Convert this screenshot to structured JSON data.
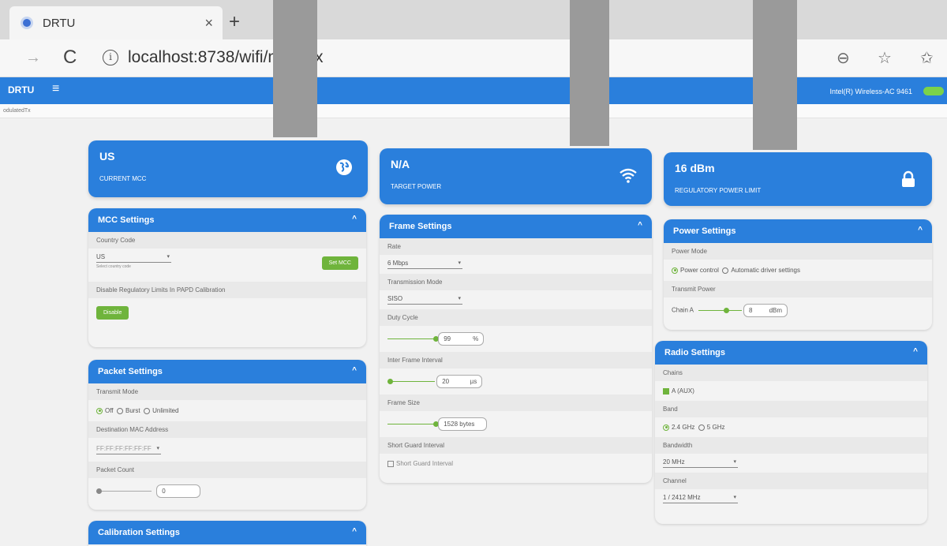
{
  "browser": {
    "tab_title": "DRTU",
    "tab_close": "×",
    "new_tab": "+",
    "forward": "→",
    "reload": "C",
    "info": "i",
    "url": "localhost:8738/wifi/mo          dTx",
    "zoom_icon": "⊖",
    "favorites_add_icon": "☆",
    "favorites_icon": "✩"
  },
  "appbar": {
    "brand": "DRTU",
    "menu_icon": "≡",
    "device": "Intel(R) Wireless-AC 9461"
  },
  "subbar": {
    "path": "odulatedTx"
  },
  "stats": {
    "mcc": {
      "value": "US",
      "label": "CURRENT MCC",
      "icon": "globe-icon"
    },
    "target_power": {
      "value": "N/A",
      "label": "TARGET POWER",
      "icon": "wifi-icon"
    },
    "reg_limit": {
      "value": "16 dBm",
      "label": "REGULATORY POWER LIMIT",
      "icon": "lock-icon"
    }
  },
  "mcc_settings": {
    "title": "MCC Settings",
    "chevron": "^",
    "country_code_label": "Country Code",
    "country_code_value": "US",
    "country_code_helper": "Select country code",
    "set_mcc_button": "Set MCC",
    "disable_label": "Disable Regulatory Limits In PAPD Calibration",
    "disable_button": "Disable"
  },
  "packet_settings": {
    "title": "Packet Settings",
    "chevron": "^",
    "transmit_mode_label": "Transmit Mode",
    "modes": [
      "Off",
      "Burst",
      "Unlimited"
    ],
    "selected_mode": "Off",
    "dest_mac_label": "Destination MAC Address",
    "dest_mac_value": "FF:FF:FF:FF:FF:FF",
    "packet_count_label": "Packet Count",
    "packet_count_value": "0"
  },
  "calibration_settings": {
    "title": "Calibration Settings",
    "chevron": "^"
  },
  "frame_settings": {
    "title": "Frame Settings",
    "chevron": "^",
    "rate_label": "Rate",
    "rate_value": "6 Mbps",
    "tx_mode_label": "Transmission Mode",
    "tx_mode_value": "SISO",
    "duty_cycle_label": "Duty Cycle",
    "duty_cycle_value": "99",
    "duty_cycle_unit": "%",
    "ifi_label": "Inter Frame Interval",
    "ifi_value": "20",
    "ifi_unit": "µs",
    "frame_size_label": "Frame Size",
    "frame_size_value": "1528",
    "frame_size_unit": "bytes",
    "sgi_label": "Short Guard Interval",
    "sgi_checkbox_label": "Short Guard Interval"
  },
  "power_settings": {
    "title": "Power Settings",
    "chevron": "^",
    "power_mode_label": "Power Mode",
    "modes": [
      "Power control",
      "Automatic driver settings"
    ],
    "transmit_power_label": "Transmit Power",
    "chain_label": "Chain A",
    "chain_value": "8",
    "chain_unit": "dBm"
  },
  "radio_settings": {
    "title": "Radio Settings",
    "chevron": "^",
    "chains_label": "Chains",
    "chain_option": "A (AUX)",
    "band_label": "Band",
    "bands": [
      "2.4 GHz",
      "5 GHz"
    ],
    "bandwidth_label": "Bandwidth",
    "bandwidth_value": "20 MHz",
    "channel_label": "Channel",
    "channel_value": "1 / 2412 MHz"
  },
  "colors": {
    "primary": "#2a7fdc",
    "accent_green": "#6fb43c"
  }
}
